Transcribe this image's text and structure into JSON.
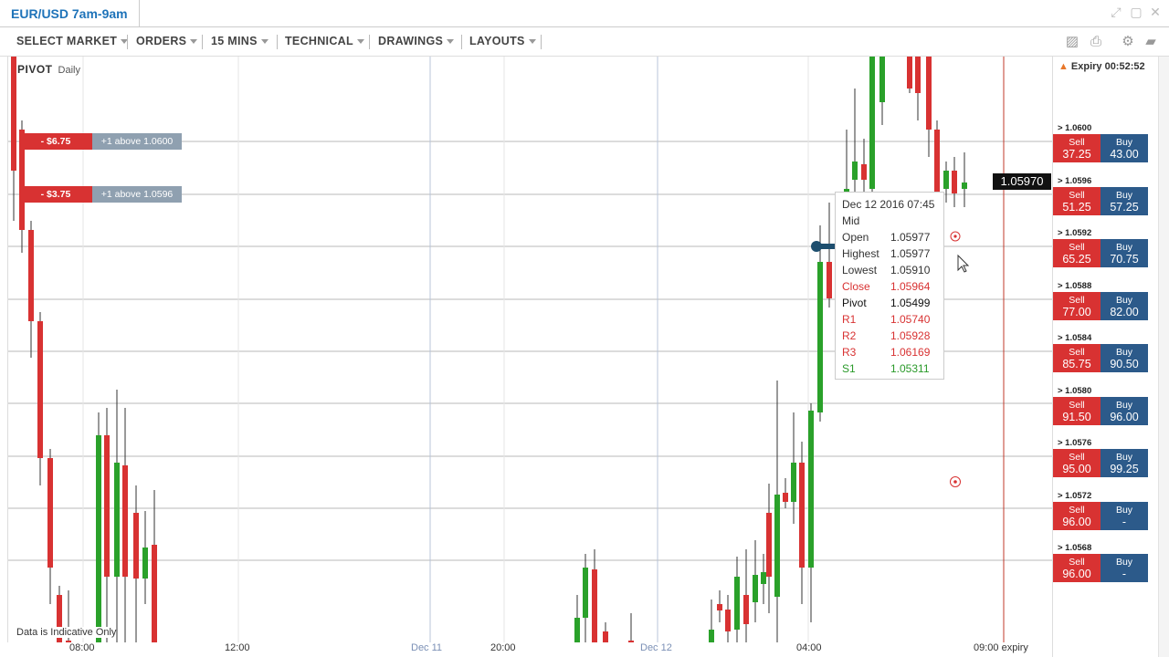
{
  "window": {
    "title": "EUR/USD 7am-9am",
    "controls": [
      "expand-icon",
      "maximize-icon",
      "close-icon"
    ]
  },
  "toolbar": {
    "menus": [
      {
        "label": "SELECT MARKET"
      },
      {
        "label": "ORDERS"
      },
      {
        "label": "15 MINS"
      },
      {
        "label": "TECHNICAL"
      },
      {
        "label": "DRAWINGS"
      },
      {
        "label": "LAYOUTS"
      }
    ],
    "icons": [
      "image-icon",
      "print-icon",
      "gear-icon",
      "chat-icon"
    ]
  },
  "chart": {
    "indicator": "PIVOT",
    "period": "Daily",
    "current_price": "1.05970",
    "disclaimer": "Data is Indicative Only",
    "orders": [
      {
        "pl": "- $6.75",
        "condition": "+1 above 1.0600"
      },
      {
        "pl": "- $3.75",
        "condition": "+1 above 1.0596"
      }
    ],
    "tooltip": {
      "datetime": "Dec 12 2016 07:45",
      "type": "Mid",
      "rows": [
        {
          "key": "Open",
          "value": "1.05977",
          "color": "#333333"
        },
        {
          "key": "Highest",
          "value": "1.05977",
          "color": "#333333"
        },
        {
          "key": "Lowest",
          "value": "1.05910",
          "color": "#333333"
        },
        {
          "key": "Close",
          "value": "1.05964",
          "color": "#d83232"
        },
        {
          "key": "Pivot",
          "value": "1.05499",
          "color": "#111111"
        },
        {
          "key": "R1",
          "value": "1.05740",
          "color": "#d83232"
        },
        {
          "key": "R2",
          "value": "1.05928",
          "color": "#d83232"
        },
        {
          "key": "R3",
          "value": "1.06169",
          "color": "#d83232"
        },
        {
          "key": "S1",
          "value": "1.05311",
          "color": "#2a9a2a"
        }
      ]
    },
    "x_ticks": [
      {
        "label": "08:00",
        "is_date": false
      },
      {
        "label": "12:00",
        "is_date": false
      },
      {
        "label": "Dec 11",
        "is_date": true
      },
      {
        "label": "20:00",
        "is_date": false
      },
      {
        "label": "Dec 12",
        "is_date": true
      },
      {
        "label": "04:00",
        "is_date": false
      },
      {
        "label": "09:00 expiry",
        "is_date": false
      }
    ]
  },
  "panel": {
    "expiry": "Expiry 00:52:52",
    "sell_label": "Sell",
    "buy_label": "Buy",
    "strikes": [
      {
        "level": "> 1.0600",
        "sell": "37.25",
        "buy": "43.00"
      },
      {
        "level": "> 1.0596",
        "sell": "51.25",
        "buy": "57.25"
      },
      {
        "level": "> 1.0592",
        "sell": "65.25",
        "buy": "70.75"
      },
      {
        "level": "> 1.0588",
        "sell": "77.00",
        "buy": "82.00"
      },
      {
        "level": "> 1.0584",
        "sell": "85.75",
        "buy": "90.50"
      },
      {
        "level": "> 1.0580",
        "sell": "91.50",
        "buy": "96.00"
      },
      {
        "level": "> 1.0576",
        "sell": "95.00",
        "buy": "99.25"
      },
      {
        "level": "> 1.0572",
        "sell": "96.00",
        "buy": "-"
      },
      {
        "level": "> 1.0568",
        "sell": "96.00",
        "buy": "-"
      }
    ]
  },
  "colors": {
    "accent": "#1e73b9",
    "sell": "#d83232",
    "buy": "#2c5a8a",
    "bull_candle": "#2aa12a",
    "bear_candle": "#d83232"
  }
}
